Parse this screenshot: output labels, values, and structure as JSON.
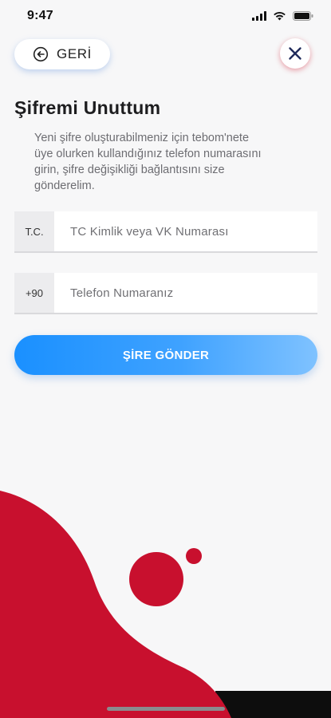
{
  "status_bar": {
    "time": "9:47",
    "icons": [
      "signal-icon",
      "wifi-icon",
      "battery-icon"
    ]
  },
  "header": {
    "back_label": "GERİ",
    "back_icon": "circle-arrow-left-icon",
    "close_icon": "close-icon"
  },
  "title": "Şifremi Unuttum",
  "description_lines": [
    "Yeni şifre oluşturabilmeniz için tebom'nete",
    "üye olurken kullandığınız telefon numarasını",
    "girin, şifre değişikliği bağlantısını size",
    "gönderelim."
  ],
  "form": {
    "id_field": {
      "prefix": "T.C.",
      "placeholder": "TC Kimlik veya VK Numarası",
      "value": ""
    },
    "phone_field": {
      "prefix": "+90",
      "placeholder": "Telefon Numaranız",
      "value": ""
    },
    "submit_label": "ŞİRE GÖNDER"
  },
  "colors": {
    "accent_blue": "#1a90ff",
    "brand_red": "#c8102e",
    "close_icon": "#1f2a5a",
    "background": "#f7f7f8"
  }
}
